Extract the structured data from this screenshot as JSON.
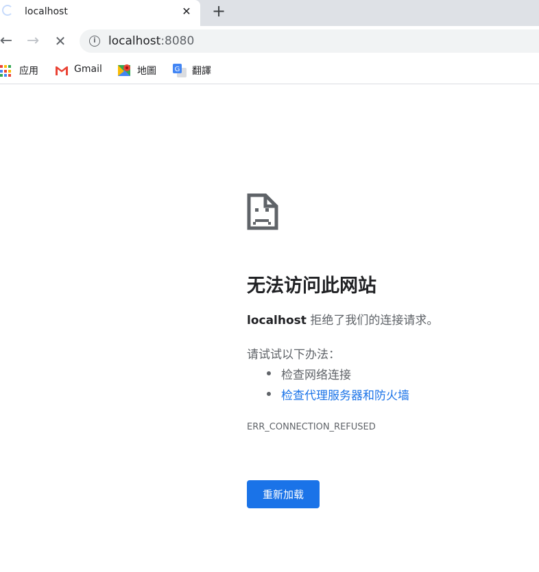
{
  "tab": {
    "title": "localhost",
    "close": "✕",
    "new_tab": "+"
  },
  "toolbar": {
    "back": "←",
    "forward": "→",
    "stop": "✕",
    "info": "i"
  },
  "omnibox": {
    "host": "localhost",
    "port": ":8080"
  },
  "bookmarks": [
    {
      "label": "应用",
      "icon": "apps-grid-icon"
    },
    {
      "label": "Gmail",
      "icon": "gmail-icon"
    },
    {
      "label": "地圖",
      "icon": "google-maps-icon"
    },
    {
      "label": "翻譯",
      "icon": "google-translate-icon"
    }
  ],
  "error": {
    "icon": "sad-page-icon",
    "headline": "无法访问此网站",
    "host": "localhost",
    "message": " 拒绝了我们的连接请求。",
    "try_label": "请试试以下办法：",
    "suggestions": [
      {
        "text": "检查网络连接",
        "link": false
      },
      {
        "text": "检查代理服务器和防火墙",
        "link": true
      }
    ],
    "code": "ERR_CONNECTION_REFUSED",
    "reload_label": "重新加载"
  },
  "colors": {
    "accent": "#1a73e8",
    "tabstrip": "#dee1e6",
    "omnibox": "#f1f3f4",
    "text_secondary": "#5f6368"
  }
}
